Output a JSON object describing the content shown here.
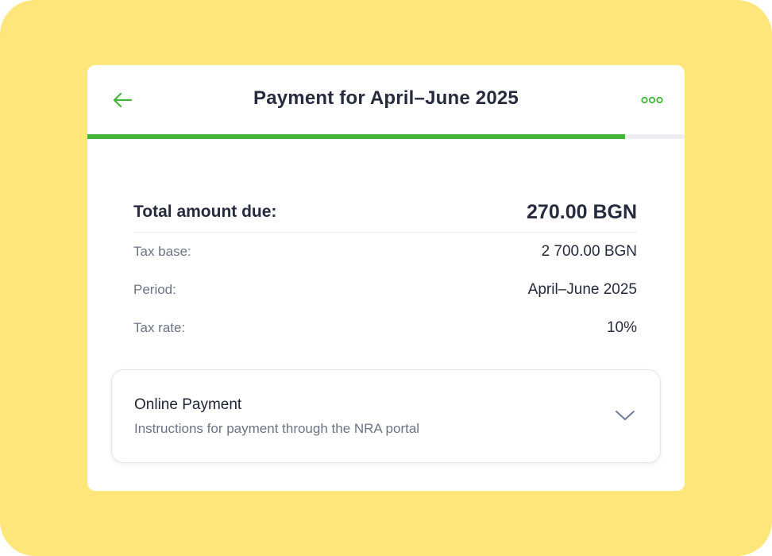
{
  "header": {
    "title": "Payment for April–June 2025",
    "back_icon": "arrow-left-icon",
    "more_icon": "more-dots-icon"
  },
  "progress": {
    "fraction": 0.9
  },
  "summary": {
    "total_label": "Total amount due:",
    "total_value": "270.00 BGN",
    "rows": [
      {
        "label": "Tax base:",
        "value": "2 700.00 BGN"
      },
      {
        "label": "Period:",
        "value": "April–June 2025"
      },
      {
        "label": "Tax rate:",
        "value": "10%"
      }
    ]
  },
  "online_payment": {
    "title": "Online Payment",
    "subtitle": "Instructions for payment through the NRA portal",
    "icon": "chevron-down-icon"
  },
  "colors": {
    "background": "#FEE67A",
    "accent": "#44B53A",
    "text": "#262B3D",
    "muted": "#6B7384"
  }
}
